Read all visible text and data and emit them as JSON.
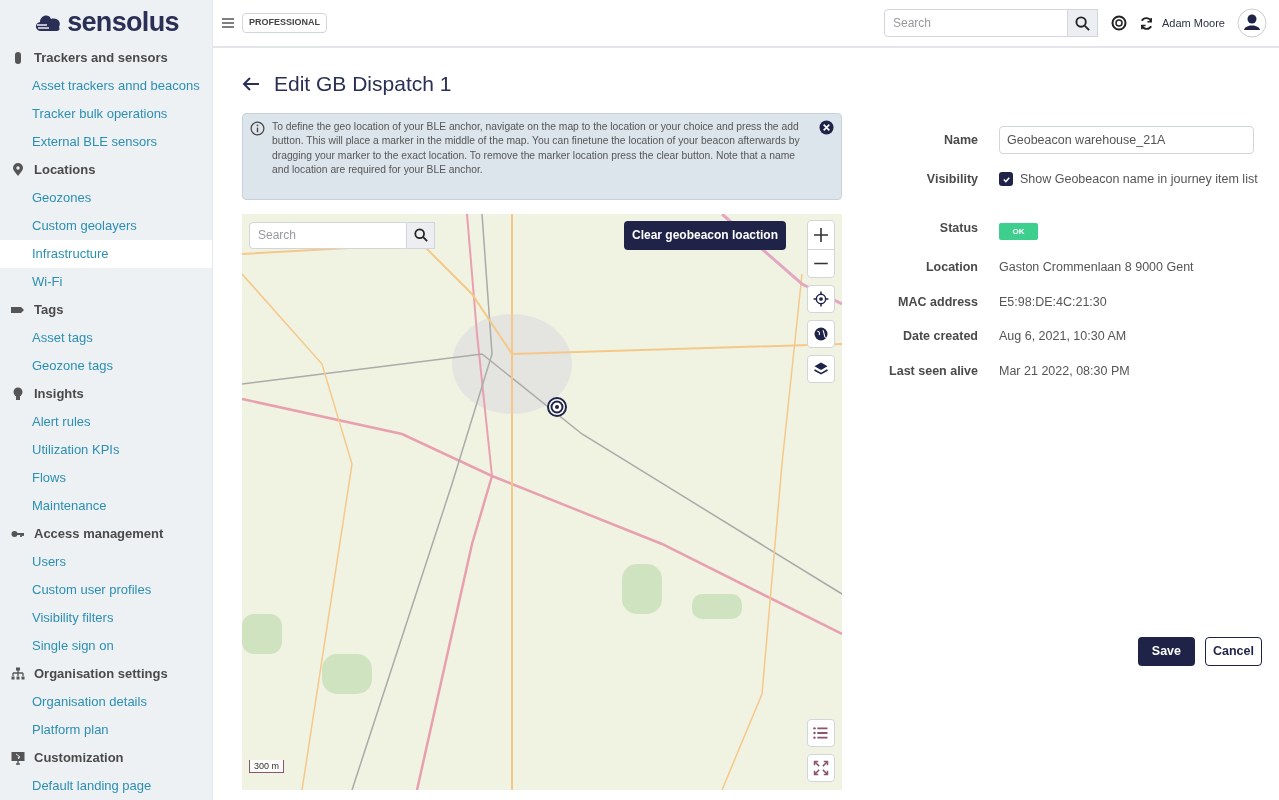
{
  "brand": {
    "name": "sensolus"
  },
  "sidebar": {
    "sections": [
      {
        "kind": "tracker",
        "title": "Trackers and sensors",
        "items": [
          {
            "label": "Asset trackers annd beacons",
            "selected": false
          },
          {
            "label": "Tracker bulk operations",
            "selected": false
          },
          {
            "label": "External BLE sensors",
            "selected": false
          }
        ]
      },
      {
        "kind": "pin",
        "title": "Locations",
        "items": [
          {
            "label": "Geozones",
            "selected": false
          },
          {
            "label": "Custom geolayers",
            "selected": false
          },
          {
            "label": "Infrastructure",
            "selected": true
          },
          {
            "label": "Wi-Fi",
            "selected": false
          }
        ]
      },
      {
        "kind": "tag",
        "title": "Tags",
        "items": [
          {
            "label": "Asset tags",
            "selected": false
          },
          {
            "label": "Geozone tags",
            "selected": false
          }
        ]
      },
      {
        "kind": "bulb",
        "title": "Insights",
        "items": [
          {
            "label": "Alert rules",
            "selected": false
          },
          {
            "label": "Utilization KPIs",
            "selected": false
          },
          {
            "label": "Flows",
            "selected": false
          },
          {
            "label": "Maintenance",
            "selected": false
          }
        ]
      },
      {
        "kind": "key",
        "title": "Access management",
        "items": [
          {
            "label": "Users",
            "selected": false
          },
          {
            "label": "Custom user profiles",
            "selected": false
          },
          {
            "label": "Visibility filters",
            "selected": false
          },
          {
            "label": "Single sign on",
            "selected": false
          }
        ]
      },
      {
        "kind": "org",
        "title": "Organisation settings",
        "items": [
          {
            "label": "Organisation details",
            "selected": false
          },
          {
            "label": "Platform plan",
            "selected": false
          }
        ]
      },
      {
        "kind": "screen",
        "title": "Customization",
        "items": [
          {
            "label": "Default landing page",
            "selected": false
          }
        ]
      }
    ]
  },
  "header": {
    "plan_badge": "PROFESSIONAL",
    "search": {
      "placeholder": "Search"
    },
    "user": "Adam Moore"
  },
  "page": {
    "title": "Edit GB Dispatch 1",
    "info": "To define the geo location of your BLE anchor, navigate on the map to the location or your choice and press the add button. This will place a marker in the middle of the map. You can finetune the location of your beacon afterwards by dragging your marker to the exact location. To remove the marker location press the clear button. Note that a name and location are required for your BLE anchor."
  },
  "map": {
    "search": {
      "placeholder": "Search"
    },
    "clear_button": "Clear geobeacon loaction",
    "scale": "300 m"
  },
  "form": {
    "name": {
      "label": "Name",
      "value": "Geobeacon warehouse_21A"
    },
    "visibility": {
      "label": "Visibility",
      "text": "Show Geobeacon name in journey item list",
      "checked": true
    },
    "status": {
      "label": "Status",
      "value": "OK",
      "color": "#3ecf8e"
    },
    "details": [
      {
        "label": "Location",
        "value": "Gaston Crommenlaan 8 9000 Gent"
      },
      {
        "label": "MAC address",
        "value": "E5:98:DE:4C:21:30"
      },
      {
        "label": "Date created",
        "value": "Aug 6, 2021, 10:30 AM"
      },
      {
        "label": "Last seen alive",
        "value": "Mar 21 2022, 08:30 PM"
      }
    ],
    "buttons": [
      {
        "label": "Save",
        "kind": "primary"
      },
      {
        "label": "Cancel",
        "kind": "secondary"
      }
    ]
  }
}
